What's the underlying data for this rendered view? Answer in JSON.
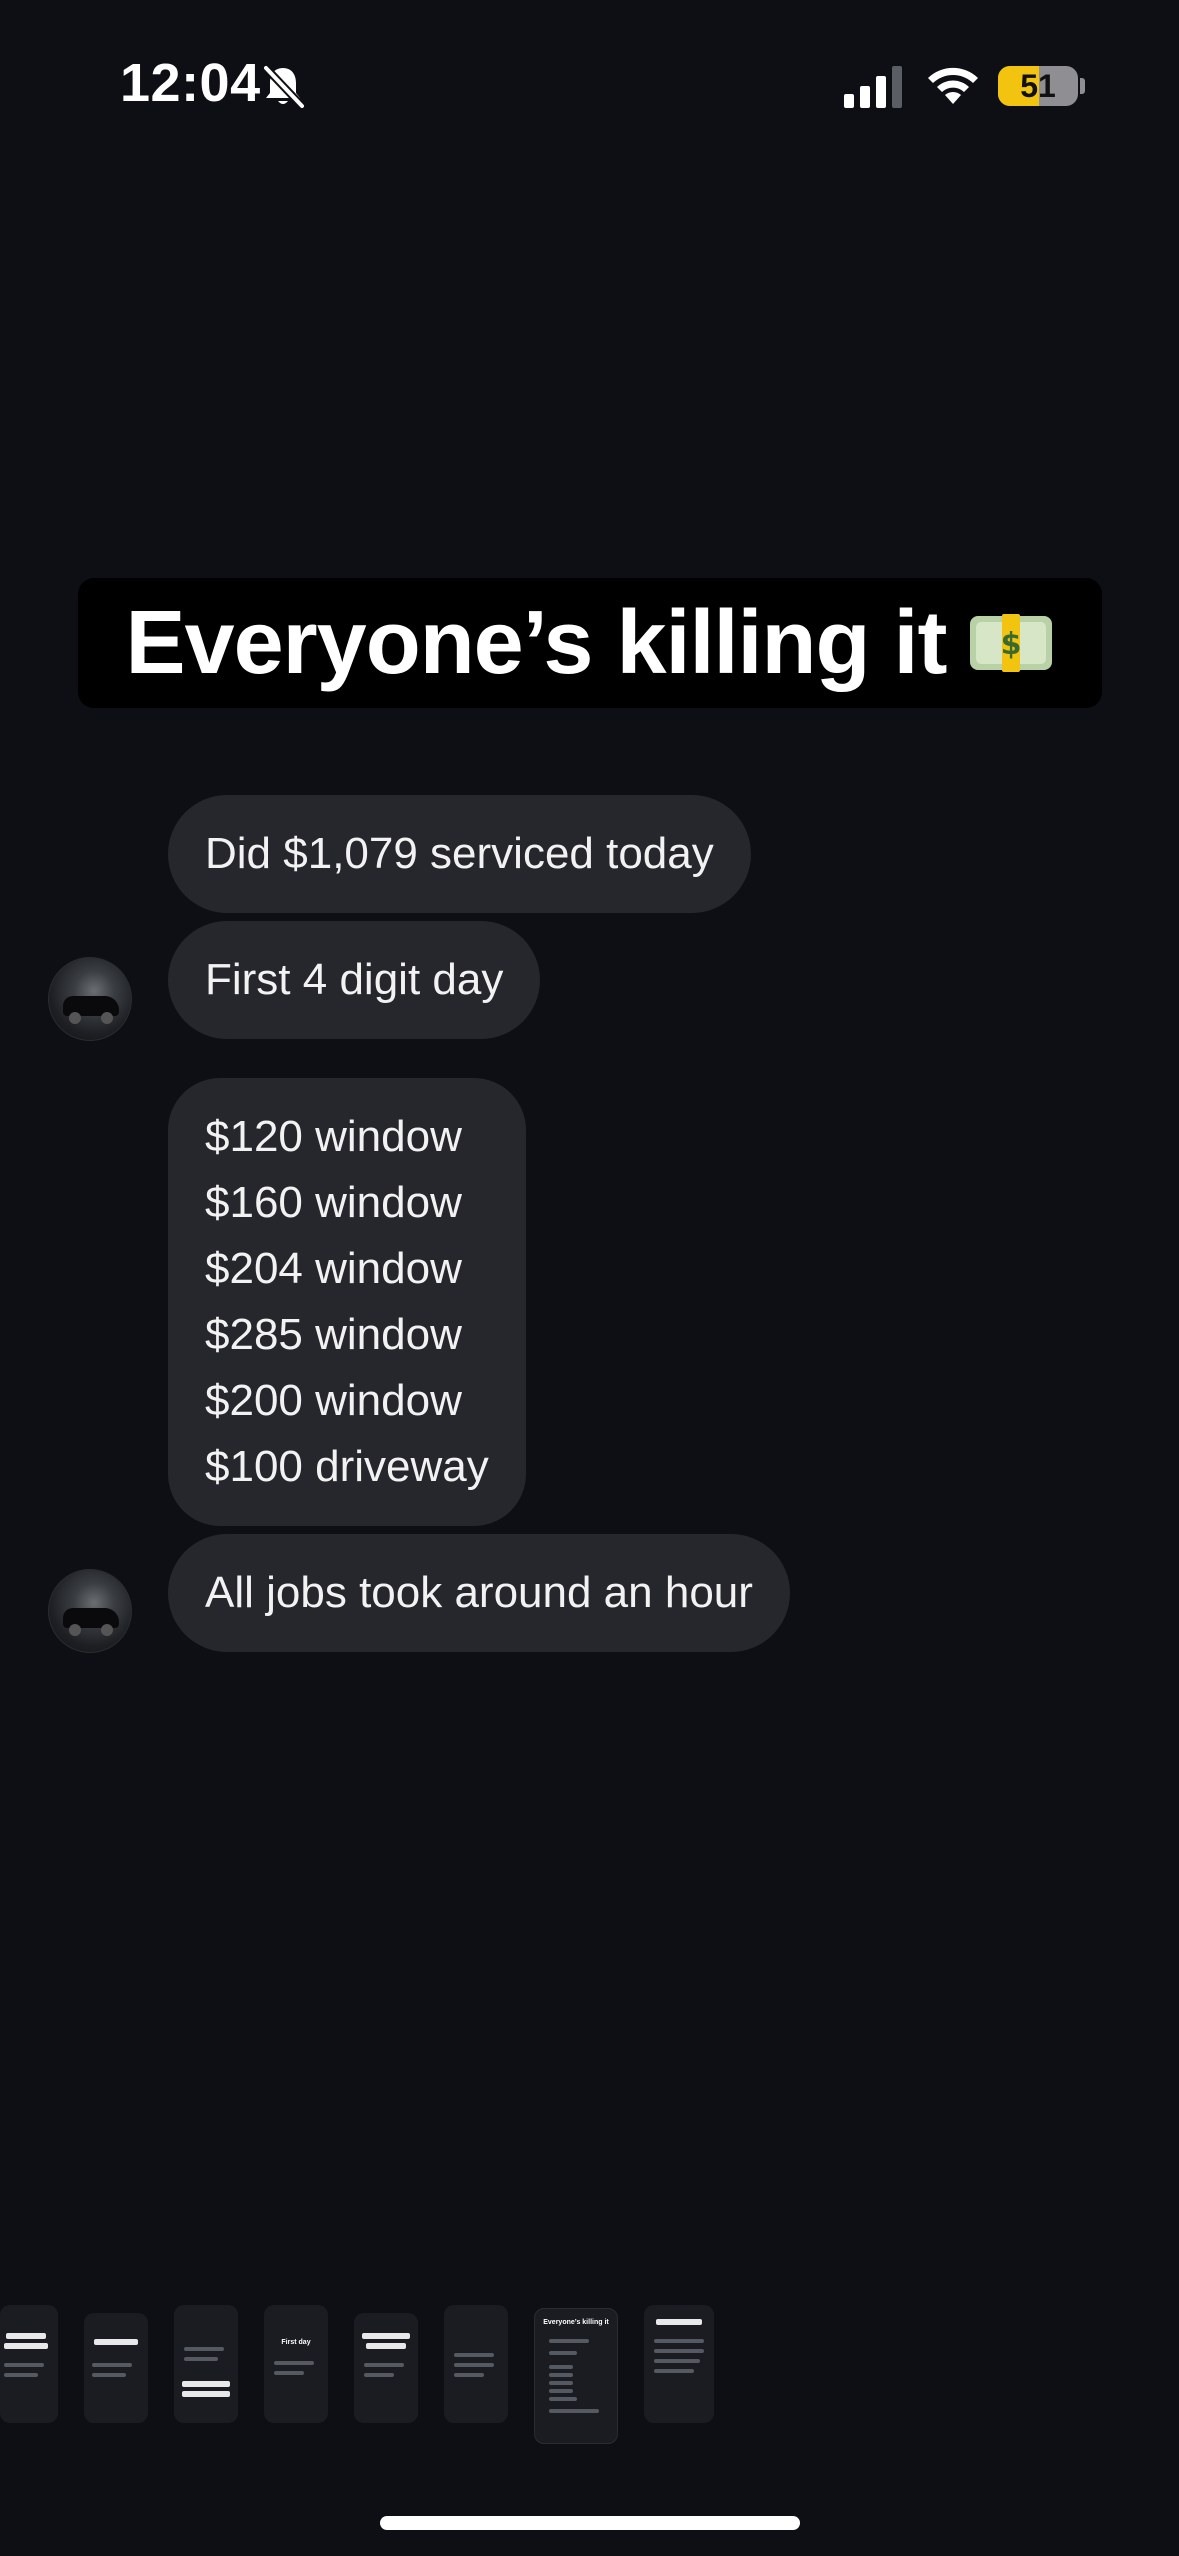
{
  "status_bar": {
    "time": "12:04",
    "battery": "51",
    "battery_level": 0.51,
    "icons": [
      "bell-slash-icon",
      "cellular-signal-icon",
      "wifi-icon",
      "battery-icon"
    ]
  },
  "title": {
    "text": "Everyone’s killing it",
    "emoji": "money-with-wings-icon"
  },
  "messages": [
    {
      "text": "Did $1,079 serviced today"
    },
    {
      "text": "First 4 digit day"
    },
    {
      "lines": [
        "$120 window",
        "$160 window",
        "$204 window",
        "$285 window",
        "$200 window",
        "$100 driveway"
      ]
    },
    {
      "text": "All jobs took around an hour"
    }
  ],
  "thumbnails": [
    {
      "label": ""
    },
    {
      "label": ""
    },
    {
      "label": ""
    },
    {
      "label": "First day"
    },
    {
      "label": ""
    },
    {
      "label": ""
    },
    {
      "label": "Everyone’s killing it"
    },
    {
      "label": ""
    }
  ],
  "colors": {
    "background": "#0d0f14",
    "bubble": "#25272c",
    "battery_accent": "#f2c40f"
  }
}
